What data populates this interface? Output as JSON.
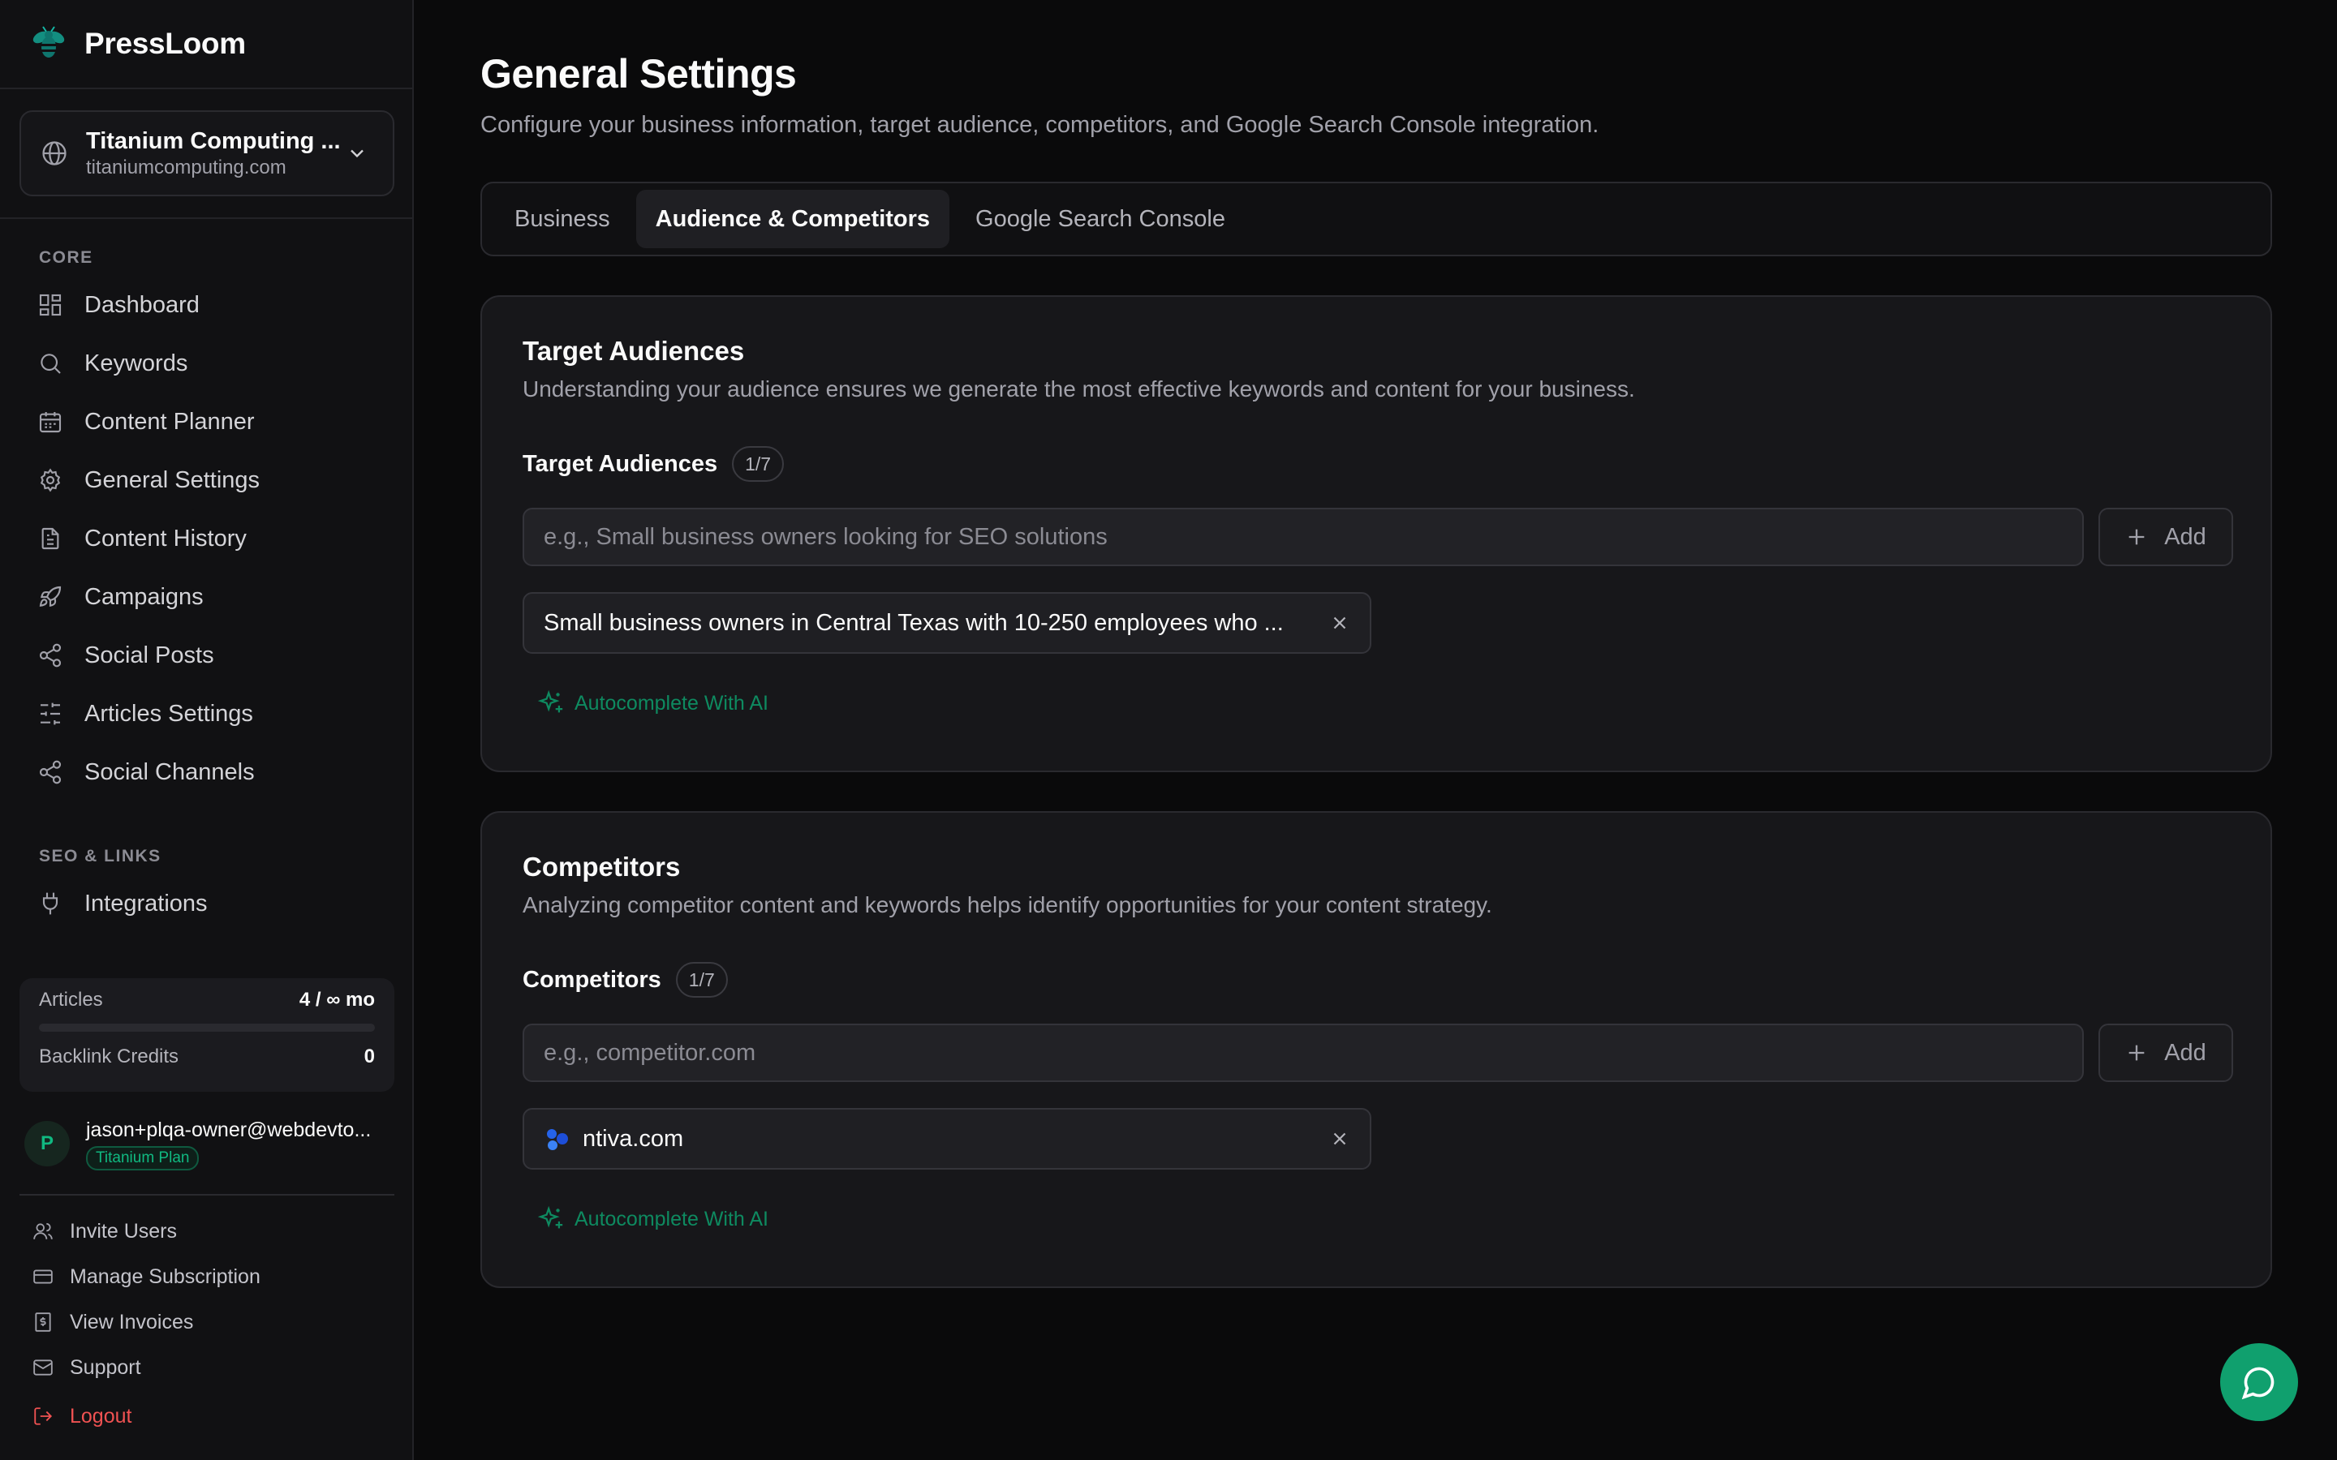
{
  "brand": {
    "name": "PressLoom"
  },
  "site_switcher": {
    "name": "Titanium Computing ...",
    "domain": "titaniumcomputing.com"
  },
  "sidebar": {
    "core_heading": "CORE",
    "core_items": [
      {
        "label": "Dashboard",
        "icon": "dashboard-icon"
      },
      {
        "label": "Keywords",
        "icon": "search-icon"
      },
      {
        "label": "Content Planner",
        "icon": "calendar-icon"
      },
      {
        "label": "General Settings",
        "icon": "gear-icon"
      },
      {
        "label": "Content History",
        "icon": "document-icon"
      },
      {
        "label": "Campaigns",
        "icon": "rocket-icon"
      },
      {
        "label": "Social Posts",
        "icon": "share-icon"
      },
      {
        "label": "Articles Settings",
        "icon": "sliders-icon"
      },
      {
        "label": "Social Channels",
        "icon": "share-icon"
      }
    ],
    "seo_heading": "SEO & LINKS",
    "seo_items": [
      {
        "label": "Integrations",
        "icon": "plug-icon"
      }
    ],
    "usage": {
      "articles_label": "Articles",
      "articles_value": "4 / ∞ mo",
      "articles_progress": 0,
      "backlink_label": "Backlink Credits",
      "backlink_value": "0"
    },
    "user": {
      "initial": "P",
      "email": "jason+plqa-owner@webdevto...",
      "plan": "Titanium Plan"
    },
    "bottom_links": {
      "invite": "Invite Users",
      "subscription": "Manage Subscription",
      "invoices": "View Invoices",
      "support": "Support",
      "logout": "Logout"
    }
  },
  "page": {
    "title": "General Settings",
    "subtitle": "Configure your business information, target audience, competitors, and Google Search Console integration."
  },
  "tabs": [
    {
      "label": "Business",
      "active": false
    },
    {
      "label": "Audience & Competitors",
      "active": true
    },
    {
      "label": "Google Search Console",
      "active": false
    }
  ],
  "audiences": {
    "title": "Target Audiences",
    "description": "Understanding your audience ensures we generate the most effective keywords and content for your business.",
    "field_label": "Target Audiences",
    "count": "1/7",
    "placeholder": "e.g., Small business owners looking for SEO solutions",
    "add_label": "Add",
    "items": [
      "Small business owners in Central Texas with 10-250 employees who ..."
    ],
    "ai_label": "Autocomplete With AI"
  },
  "competitors": {
    "title": "Competitors",
    "description": "Analyzing competitor content and keywords helps identify opportunities for your content strategy.",
    "field_label": "Competitors",
    "count": "1/7",
    "placeholder": "e.g., competitor.com",
    "add_label": "Add",
    "items": [
      "ntiva.com"
    ],
    "ai_label": "Autocomplete With AI"
  },
  "colors": {
    "accent": "#10b981",
    "ai_link": "#0e8a60",
    "chat_button": "#10a06e",
    "logout": "#f05252",
    "background": "#0a0a0b",
    "sidebar": "#111113",
    "card": "#17171a"
  },
  "chat": {
    "icon": "chat-bubble-icon"
  }
}
